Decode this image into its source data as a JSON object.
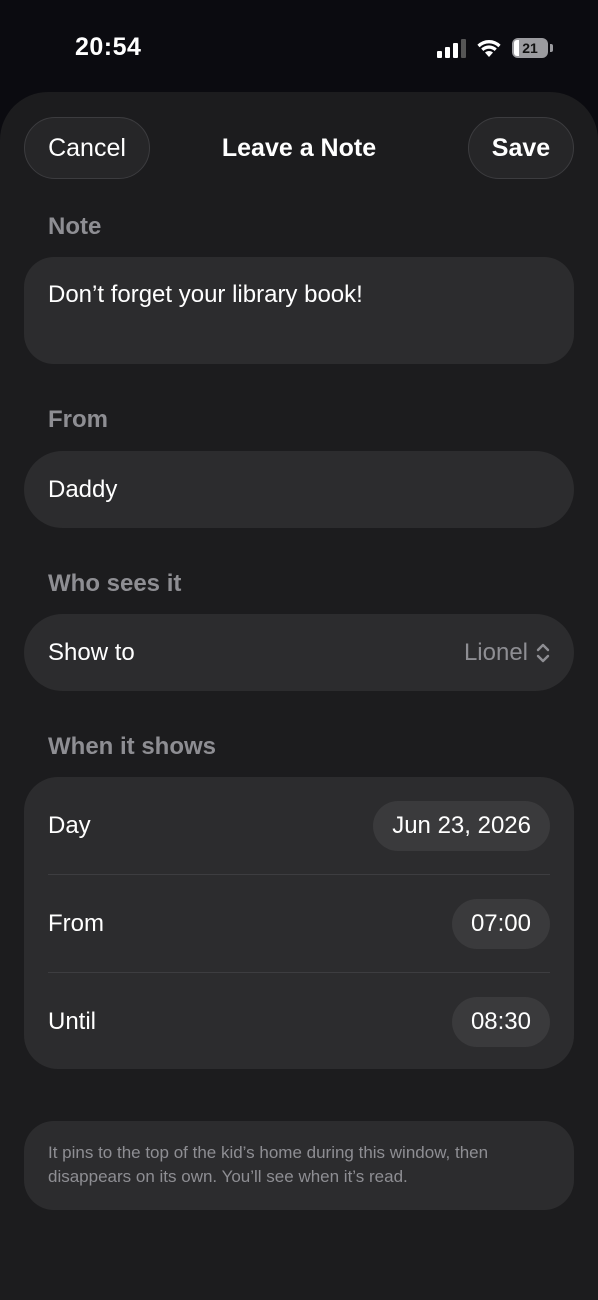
{
  "status_bar": {
    "time": "20:54",
    "battery_level": "21",
    "icons": [
      "cellular-signal-icon",
      "wifi-icon",
      "battery-icon"
    ]
  },
  "nav": {
    "cancel_label": "Cancel",
    "title": "Leave a Note",
    "save_label": "Save"
  },
  "note": {
    "section_label": "Note",
    "value": "Don’t forget your library book!"
  },
  "from": {
    "section_label": "From",
    "value": "Daddy"
  },
  "who_sees": {
    "section_label": "Who sees it",
    "row_label": "Show to",
    "selected": "Lionel"
  },
  "when": {
    "section_label": "When it shows",
    "day_label": "Day",
    "day_value": "Jun 23, 2026",
    "from_label": "From",
    "from_value": "07:00",
    "until_label": "Until",
    "until_value": "08:30"
  },
  "info_text": "It pins to the top of the kid’s home during this window, then disappears on its own. You’ll see when it’s read.",
  "colors": {
    "background": "#0b0b10",
    "sheet": "#1c1c1e",
    "card": "#2c2c2e",
    "chip": "#3a3a3c",
    "secondary_text": "#8e8e93"
  }
}
